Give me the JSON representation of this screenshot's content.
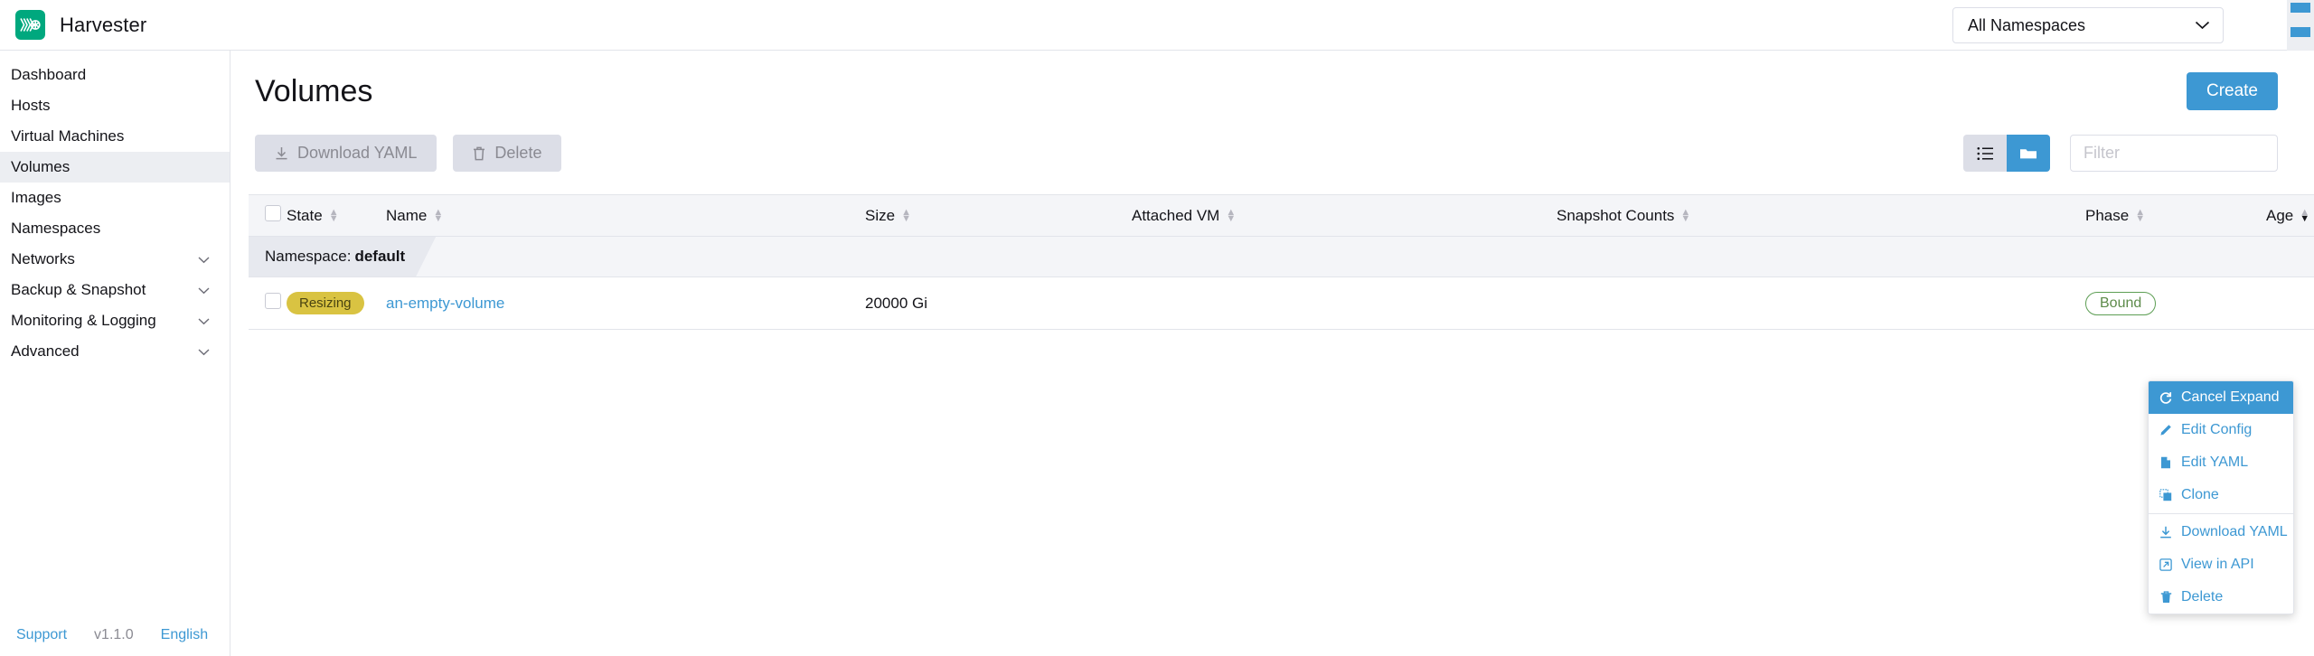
{
  "header": {
    "brand_name": "Harvester",
    "logo_icon": "harvester-logo-icon",
    "namespace_selector": {
      "value": "All Namespaces",
      "chevron_icon": "chevron-down-icon"
    }
  },
  "sidebar": {
    "items": [
      {
        "label": "Dashboard",
        "active": false,
        "expandable": false
      },
      {
        "label": "Hosts",
        "active": false,
        "expandable": false
      },
      {
        "label": "Virtual Machines",
        "active": false,
        "expandable": false
      },
      {
        "label": "Volumes",
        "active": true,
        "expandable": false
      },
      {
        "label": "Images",
        "active": false,
        "expandable": false
      },
      {
        "label": "Namespaces",
        "active": false,
        "expandable": false
      },
      {
        "label": "Networks",
        "active": false,
        "expandable": true
      },
      {
        "label": "Backup & Snapshot",
        "active": false,
        "expandable": true
      },
      {
        "label": "Monitoring & Logging",
        "active": false,
        "expandable": true
      },
      {
        "label": "Advanced",
        "active": false,
        "expandable": true
      }
    ],
    "footer": {
      "support": "Support",
      "version": "v1.1.0",
      "language": "English"
    }
  },
  "main": {
    "page_title": "Volumes",
    "create_button": "Create",
    "toolbar": {
      "download_yaml": "Download YAML",
      "download_icon": "download-icon",
      "delete": "Delete",
      "delete_icon": "trash-icon",
      "view_flat_icon": "list-view-icon",
      "view_grouped_icon": "folder-group-icon",
      "filter_placeholder": "Filter",
      "filter_value": ""
    },
    "table": {
      "columns": [
        {
          "label": "",
          "sortable": false,
          "sorted": "none"
        },
        {
          "label": "State",
          "sortable": true,
          "sorted": "none"
        },
        {
          "label": "Name",
          "sortable": true,
          "sorted": "none"
        },
        {
          "label": "Size",
          "sortable": true,
          "sorted": "none"
        },
        {
          "label": "Attached VM",
          "sortable": true,
          "sorted": "none"
        },
        {
          "label": "Snapshot Counts",
          "sortable": true,
          "sorted": "none"
        },
        {
          "label": "Phase",
          "sortable": true,
          "sorted": "none"
        },
        {
          "label": "Age",
          "sortable": true,
          "sorted": "desc"
        }
      ],
      "group": {
        "prefix": "Namespace:",
        "value": "default"
      },
      "rows": [
        {
          "state": "Resizing",
          "name": "an-empty-volume",
          "size": "20000 Gi",
          "attached_vm": "",
          "snapshot_counts": "",
          "phase": "Bound",
          "age": "",
          "actions_icon": "kebab-menu-icon"
        }
      ]
    },
    "context_menu": {
      "items": [
        {
          "label": "Cancel Expand",
          "icon": "refresh-icon",
          "highlighted": true,
          "separator_after": false
        },
        {
          "label": "Edit Config",
          "icon": "pencil-icon",
          "highlighted": false,
          "separator_after": false
        },
        {
          "label": "Edit YAML",
          "icon": "file-icon",
          "highlighted": false,
          "separator_after": false
        },
        {
          "label": "Clone",
          "icon": "copy-icon",
          "highlighted": false,
          "separator_after": true
        },
        {
          "label": "Download YAML",
          "icon": "download-icon",
          "highlighted": false,
          "separator_after": false
        },
        {
          "label": "View in API",
          "icon": "external-link-icon",
          "highlighted": false,
          "separator_after": false
        },
        {
          "label": "Delete",
          "icon": "trash-icon",
          "highlighted": false,
          "separator_after": false
        }
      ]
    }
  },
  "colors": {
    "brand_green": "#00a87e",
    "accent_blue": "#3d98d3",
    "state_resizing": "#d9c342",
    "phase_bound": "#5d9e54",
    "panel_grey": "#f4f5f8"
  }
}
